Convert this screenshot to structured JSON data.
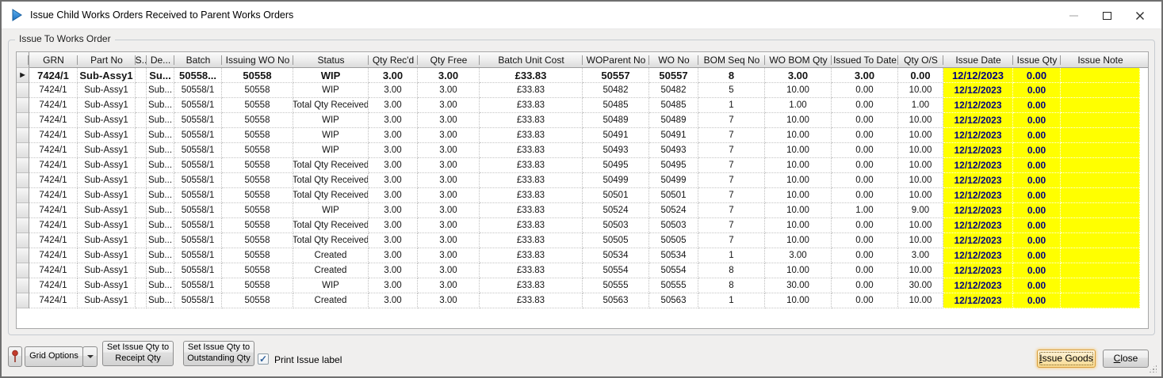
{
  "window": {
    "title": "Issue Child Works Orders Received to Parent Works Orders"
  },
  "groupbox": {
    "label": "Issue To Works Order"
  },
  "grid": {
    "columns": [
      "GRN",
      "Part No",
      "S..",
      "De...",
      "Batch",
      "Issuing WO No",
      "Status",
      "Qty Rec'd",
      "Qty Free",
      "Batch Unit Cost",
      "WOParent No",
      "WO No",
      "BOM Seq No",
      "WO BOM Qty",
      "Issued To Date",
      "Qty O/S",
      "Issue Date",
      "Issue Qty",
      "Issue Note"
    ],
    "rows": [
      {
        "bold": true,
        "current": true,
        "cells": [
          "7424/1",
          "Sub-Assy1",
          "",
          "Su...",
          "50558...",
          "50558",
          "WIP",
          "3.00",
          "3.00",
          "£33.83",
          "50557",
          "50557",
          "8",
          "3.00",
          "3.00",
          "0.00",
          "12/12/2023",
          "0.00",
          ""
        ]
      },
      {
        "cells": [
          "7424/1",
          "Sub-Assy1",
          "",
          "Sub...",
          "50558/1",
          "50558",
          "WIP",
          "3.00",
          "3.00",
          "£33.83",
          "50482",
          "50482",
          "5",
          "10.00",
          "0.00",
          "10.00",
          "12/12/2023",
          "0.00",
          ""
        ]
      },
      {
        "cells": [
          "7424/1",
          "Sub-Assy1",
          "",
          "Sub...",
          "50558/1",
          "50558",
          "Total Qty Received",
          "3.00",
          "3.00",
          "£33.83",
          "50485",
          "50485",
          "1",
          "1.00",
          "0.00",
          "1.00",
          "12/12/2023",
          "0.00",
          ""
        ]
      },
      {
        "cells": [
          "7424/1",
          "Sub-Assy1",
          "",
          "Sub...",
          "50558/1",
          "50558",
          "WIP",
          "3.00",
          "3.00",
          "£33.83",
          "50489",
          "50489",
          "7",
          "10.00",
          "0.00",
          "10.00",
          "12/12/2023",
          "0.00",
          ""
        ]
      },
      {
        "cells": [
          "7424/1",
          "Sub-Assy1",
          "",
          "Sub...",
          "50558/1",
          "50558",
          "WIP",
          "3.00",
          "3.00",
          "£33.83",
          "50491",
          "50491",
          "7",
          "10.00",
          "0.00",
          "10.00",
          "12/12/2023",
          "0.00",
          ""
        ]
      },
      {
        "cells": [
          "7424/1",
          "Sub-Assy1",
          "",
          "Sub...",
          "50558/1",
          "50558",
          "WIP",
          "3.00",
          "3.00",
          "£33.83",
          "50493",
          "50493",
          "7",
          "10.00",
          "0.00",
          "10.00",
          "12/12/2023",
          "0.00",
          ""
        ]
      },
      {
        "cells": [
          "7424/1",
          "Sub-Assy1",
          "",
          "Sub...",
          "50558/1",
          "50558",
          "Total Qty Received",
          "3.00",
          "3.00",
          "£33.83",
          "50495",
          "50495",
          "7",
          "10.00",
          "0.00",
          "10.00",
          "12/12/2023",
          "0.00",
          ""
        ]
      },
      {
        "cells": [
          "7424/1",
          "Sub-Assy1",
          "",
          "Sub...",
          "50558/1",
          "50558",
          "Total Qty Received",
          "3.00",
          "3.00",
          "£33.83",
          "50499",
          "50499",
          "7",
          "10.00",
          "0.00",
          "10.00",
          "12/12/2023",
          "0.00",
          ""
        ]
      },
      {
        "cells": [
          "7424/1",
          "Sub-Assy1",
          "",
          "Sub...",
          "50558/1",
          "50558",
          "Total Qty Received",
          "3.00",
          "3.00",
          "£33.83",
          "50501",
          "50501",
          "7",
          "10.00",
          "0.00",
          "10.00",
          "12/12/2023",
          "0.00",
          ""
        ]
      },
      {
        "cells": [
          "7424/1",
          "Sub-Assy1",
          "",
          "Sub...",
          "50558/1",
          "50558",
          "WIP",
          "3.00",
          "3.00",
          "£33.83",
          "50524",
          "50524",
          "7",
          "10.00",
          "1.00",
          "9.00",
          "12/12/2023",
          "0.00",
          ""
        ]
      },
      {
        "cells": [
          "7424/1",
          "Sub-Assy1",
          "",
          "Sub...",
          "50558/1",
          "50558",
          "Total Qty Received",
          "3.00",
          "3.00",
          "£33.83",
          "50503",
          "50503",
          "7",
          "10.00",
          "0.00",
          "10.00",
          "12/12/2023",
          "0.00",
          ""
        ]
      },
      {
        "cells": [
          "7424/1",
          "Sub-Assy1",
          "",
          "Sub...",
          "50558/1",
          "50558",
          "Total Qty Received",
          "3.00",
          "3.00",
          "£33.83",
          "50505",
          "50505",
          "7",
          "10.00",
          "0.00",
          "10.00",
          "12/12/2023",
          "0.00",
          ""
        ]
      },
      {
        "cells": [
          "7424/1",
          "Sub-Assy1",
          "",
          "Sub...",
          "50558/1",
          "50558",
          "Created",
          "3.00",
          "3.00",
          "£33.83",
          "50534",
          "50534",
          "1",
          "3.00",
          "0.00",
          "3.00",
          "12/12/2023",
          "0.00",
          ""
        ]
      },
      {
        "cells": [
          "7424/1",
          "Sub-Assy1",
          "",
          "Sub...",
          "50558/1",
          "50558",
          "Created",
          "3.00",
          "3.00",
          "£33.83",
          "50554",
          "50554",
          "8",
          "10.00",
          "0.00",
          "10.00",
          "12/12/2023",
          "0.00",
          ""
        ]
      },
      {
        "cells": [
          "7424/1",
          "Sub-Assy1",
          "",
          "Sub...",
          "50558/1",
          "50558",
          "WIP",
          "3.00",
          "3.00",
          "£33.83",
          "50555",
          "50555",
          "8",
          "30.00",
          "0.00",
          "30.00",
          "12/12/2023",
          "0.00",
          ""
        ]
      },
      {
        "cells": [
          "7424/1",
          "Sub-Assy1",
          "",
          "Sub...",
          "50558/1",
          "50558",
          "Created",
          "3.00",
          "3.00",
          "£33.83",
          "50563",
          "50563",
          "1",
          "10.00",
          "0.00",
          "10.00",
          "12/12/2023",
          "0.00",
          ""
        ]
      }
    ]
  },
  "footer": {
    "grid_options_label": "Grid Options",
    "set_receipt_label": [
      "Set Issue Qty to",
      "Receipt Qty"
    ],
    "set_outstanding_label": [
      "Set Issue Qty to",
      "Outstanding Qty"
    ],
    "print_checkbox": {
      "label": "Print Issue label",
      "checked": true,
      "mark": "✓"
    },
    "issue_goods_label": "Issue Goods",
    "close_label": "Close"
  },
  "colors": {
    "issue_highlight": "#ffff00",
    "issue_text": "#000080",
    "issue_goods_border": "#d89e3e",
    "title_icon_blue": "#2e86d3"
  }
}
